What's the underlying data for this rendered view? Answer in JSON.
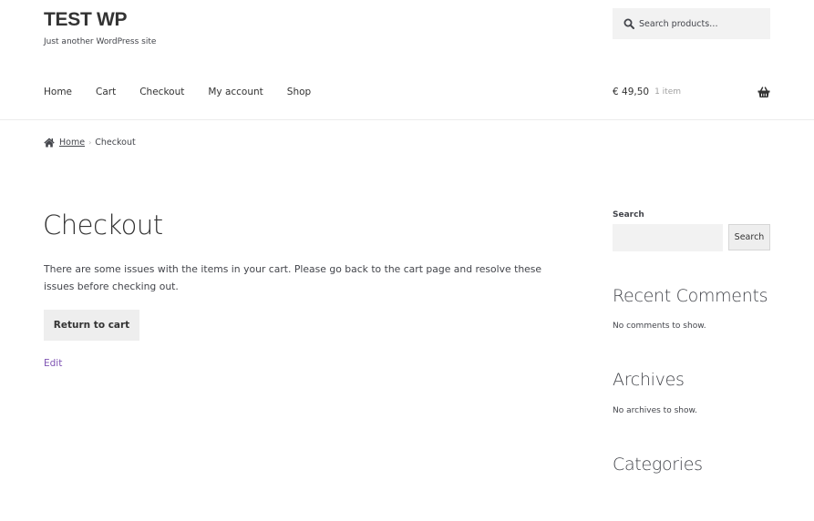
{
  "header": {
    "site_title": "TEST WP",
    "tagline": "Just another WordPress site",
    "search_placeholder": "Search products…",
    "search_icon": "search-icon",
    "nav": [
      {
        "label": "Home"
      },
      {
        "label": "Cart"
      },
      {
        "label": "Checkout"
      },
      {
        "label": "My account"
      },
      {
        "label": "Shop"
      }
    ],
    "cart": {
      "amount": "€ 49,50",
      "count": "1 item",
      "icon": "basket-icon"
    }
  },
  "breadcrumb": {
    "icon": "home-icon",
    "home": "Home",
    "separator": "›",
    "current": "Checkout"
  },
  "main": {
    "title": "Checkout",
    "notice": "There are some issues with the items in your cart. Please go back to the cart page and resolve these issues before checking out.",
    "return_button": "Return to cart",
    "edit_link": "Edit"
  },
  "sidebar": {
    "search": {
      "label": "Search",
      "input_value": "",
      "button": "Search"
    },
    "recent_comments": {
      "title": "Recent Comments",
      "text": "No comments to show."
    },
    "archives": {
      "title": "Archives",
      "text": "No archives to show."
    },
    "categories": {
      "title": "Categories"
    }
  },
  "colors": {
    "link_accent": "#7f54b3",
    "text": "#43454b",
    "heading": "#333333",
    "button_bg": "#eeeeee",
    "input_bg": "#f2f2f2"
  }
}
